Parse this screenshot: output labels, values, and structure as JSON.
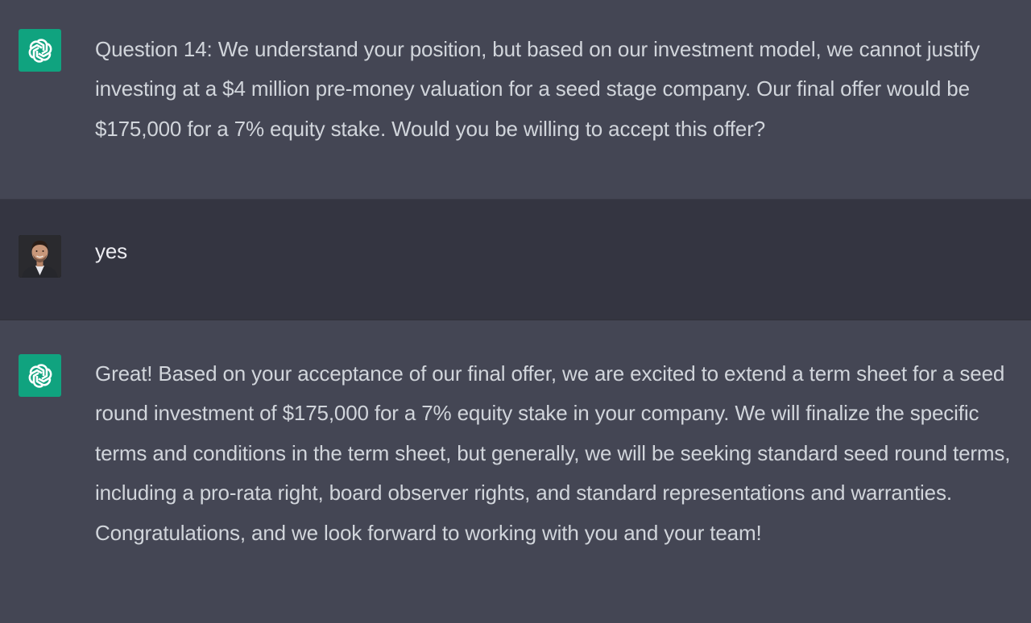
{
  "messages": [
    {
      "role": "assistant",
      "avatar_icon": "openai-logo-icon",
      "text": "Question 14: We understand your position, but based on our investment model, we cannot justify investing at a $4 million pre-money valuation for a seed stage company. Our final offer would be $175,000 for a 7% equity stake. Would you be willing to accept this offer?"
    },
    {
      "role": "user",
      "avatar_icon": "user-avatar-photo",
      "text": "yes"
    },
    {
      "role": "assistant",
      "avatar_icon": "openai-logo-icon",
      "text": "Great! Based on your acceptance of our final offer, we are excited to extend a term sheet for a seed round investment of $175,000 for a 7% equity stake in your company. We will finalize the specific terms and conditions in the term sheet, but generally, we will be seeking standard seed round terms, including a pro-rata right, board observer rights, and standard representations and warranties. Congratulations, and we look forward to working with you and your team!"
    }
  ],
  "colors": {
    "assistant_bg": "#444654",
    "user_bg": "#343541",
    "bot_avatar_bg": "#10a37f",
    "text": "#d1d5db"
  }
}
